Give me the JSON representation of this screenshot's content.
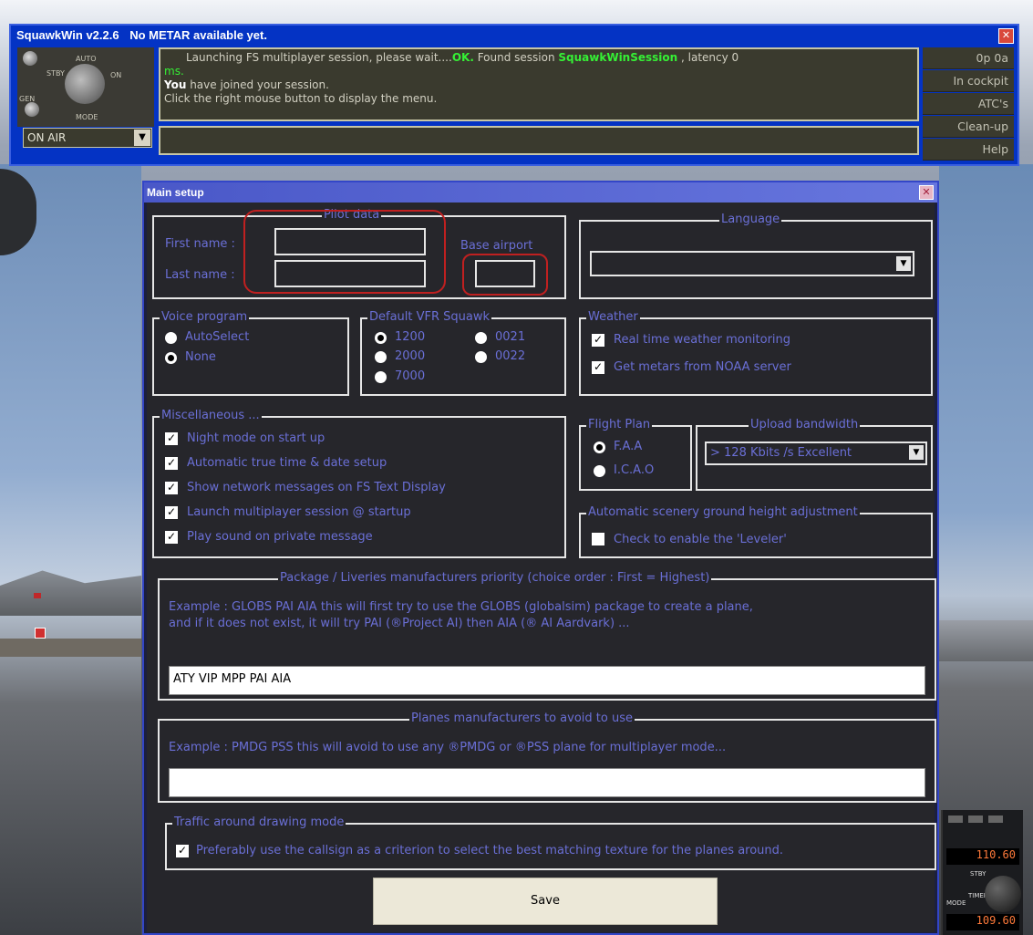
{
  "squawkwin": {
    "title": "SquawkWin  v2.2.6",
    "status": "No METAR available yet.",
    "knob_labels": {
      "stby": "STBY",
      "auto": "AUTO",
      "on": "ON",
      "gen": "GEN",
      "mode": "MODE"
    },
    "messages": {
      "line1_prefix": "Launching FS multiplayer session, please wait....",
      "line1_ok": "OK.",
      "line1_found": " Found session ",
      "line1_session": "SquawkWinSession",
      "line1_latency": " , latency 0",
      "line2": "ms.",
      "line3_you": "You",
      "line3_rest": " have joined your session.",
      "line4": "Click the right mouse button to display the menu."
    },
    "mode_select": "ON AIR",
    "side_buttons": [
      "0p  0a",
      "In cockpit",
      "ATC's",
      "Clean-up",
      "Help"
    ]
  },
  "main_setup": {
    "title": "Main setup",
    "pilot_data": {
      "legend": "Pilot data",
      "first_name_label": "First name :",
      "last_name_label": "Last name :",
      "first_name_value": "",
      "last_name_value": "",
      "base_airport_label": "Base airport",
      "base_airport_value": ""
    },
    "language": {
      "legend": "Language",
      "value": ""
    },
    "voice_program": {
      "legend": "Voice program",
      "options": [
        {
          "label": "AutoSelect",
          "selected": false
        },
        {
          "label": "None",
          "selected": true
        }
      ]
    },
    "vfr_squawk": {
      "legend": "Default VFR Squawk",
      "options": [
        {
          "label": "1200",
          "selected": true
        },
        {
          "label": "0021",
          "selected": false
        },
        {
          "label": "2000",
          "selected": false
        },
        {
          "label": "0022",
          "selected": false
        },
        {
          "label": "7000",
          "selected": false
        }
      ]
    },
    "weather": {
      "legend": "Weather",
      "options": [
        {
          "label": "Real time weather monitoring",
          "checked": true
        },
        {
          "label": "Get metars from NOAA server",
          "checked": true
        }
      ]
    },
    "miscellaneous": {
      "legend": "Miscellaneous ...",
      "options": [
        {
          "label": "Night mode on start up",
          "checked": true
        },
        {
          "label": "Automatic true time & date setup",
          "checked": true
        },
        {
          "label": "Show network messages on FS Text Display",
          "checked": true
        },
        {
          "label": "Launch multiplayer session @ startup",
          "checked": true
        },
        {
          "label": "Play sound on private message",
          "checked": true
        }
      ]
    },
    "flight_plan": {
      "legend": "Flight Plan",
      "options": [
        {
          "label": "F.A.A",
          "selected": true
        },
        {
          "label": "I.C.A.O",
          "selected": false
        }
      ]
    },
    "upload_bandwidth": {
      "legend": "Upload bandwidth",
      "value": "> 128 Kbits /s Excellent"
    },
    "leveler": {
      "legend": "Automatic scenery ground height adjustment",
      "label": "Check to enable the 'Leveler'",
      "checked": false
    },
    "liveries": {
      "legend": "Package / Liveries manufacturers priority (choice order : First = Highest)",
      "example_line1": "Example : GLOBS PAI AIA this will first try to use the GLOBS (globalsim) package to create a plane,",
      "example_line2": "and if it does not exist, it will try PAI (®Project AI) then AIA (® AI Aardvark) ...",
      "value": "ATY VIP MPP PAI AIA"
    },
    "avoid": {
      "legend": "Planes manufacturers to avoid to use",
      "example": "Example : PMDG PSS this will avoid to use any ®PMDG or ®PSS plane for multiplayer mode...",
      "value": ""
    },
    "traffic": {
      "legend": "Traffic around drawing mode",
      "label": "Preferably use the callsign as a criterion to select the best matching texture for the planes around.",
      "checked": true
    },
    "save_label": "Save"
  },
  "cockpit_readouts": {
    "com1": "110.60",
    "nav": "109.60",
    "stby": "STBY",
    "timer": "TIMER",
    "mode": "MODE"
  },
  "colors": {
    "accent": "#6a6fd6",
    "title_blue": "#0433c4",
    "dialog_bg": "#26262b",
    "ok_green": "#35f035"
  }
}
